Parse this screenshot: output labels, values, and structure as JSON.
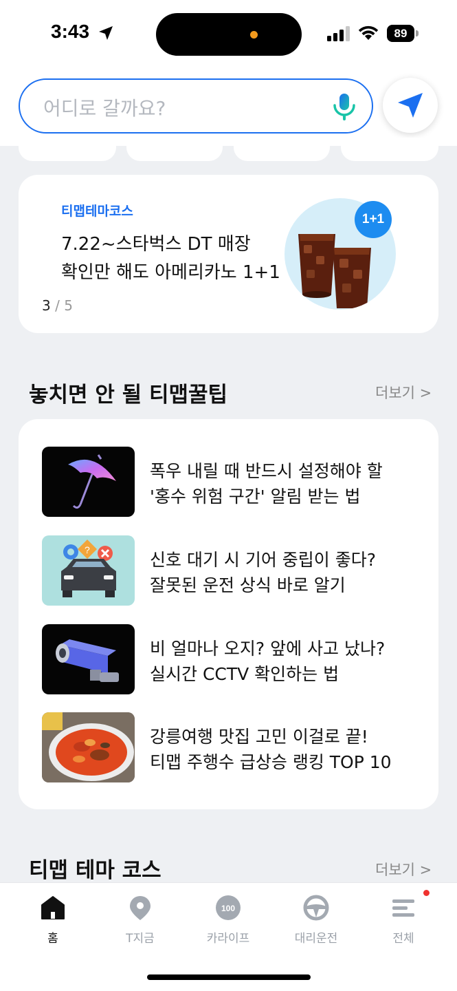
{
  "status_bar": {
    "time": "3:43",
    "battery": "89"
  },
  "search": {
    "placeholder": "어디로 갈까요?"
  },
  "banner": {
    "tag": "티맵테마코스",
    "line1": "7.22~스타벅스 DT 매장",
    "line2": "확인만 해도 아메리카노 1+1",
    "page_current": "3",
    "page_total": "/ 5",
    "badge": "1+1"
  },
  "tips_section": {
    "title": "놓치면 안 될 티맵꿀팁",
    "more": "더보기 >",
    "items": [
      {
        "line1": "폭우 내릴 때 반드시 설정해야 할",
        "line2": "'홍수 위험 구간' 알림 받는 법"
      },
      {
        "line1": "신호 대기 시 기어 중립이 좋다?",
        "line2": "잘못된 운전 상식 바로 알기"
      },
      {
        "line1": "비 얼마나 오지? 앞에 사고 났나?",
        "line2": "실시간 CCTV 확인하는 법"
      },
      {
        "line1": "강릉여행 맛집 고민 이걸로 끝!",
        "line2": "티맵 주행수 급상승 랭킹 TOP 10"
      }
    ]
  },
  "theme_section": {
    "title": "티맵 테마 코스",
    "more": "더보기 >"
  },
  "tab_bar": {
    "tabs": [
      {
        "label": "홈",
        "icon": "home-icon"
      },
      {
        "label": "T지금",
        "icon": "location-pin-icon"
      },
      {
        "label": "카라이프",
        "icon": "speedometer-icon"
      },
      {
        "label": "대리운전",
        "icon": "steering-wheel-icon"
      },
      {
        "label": "전체",
        "icon": "menu-icon"
      }
    ],
    "speedometer_value": "100"
  },
  "colors": {
    "accent": "#1b6ff0",
    "badge": "#1d8cf0",
    "notification": "#f0322f"
  }
}
